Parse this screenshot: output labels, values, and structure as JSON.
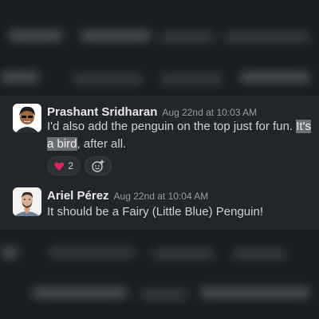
{
  "messages": [
    {
      "author": "Prashant Sridharan",
      "timestamp": "Aug 22nd at 10:03 AM",
      "text_before": "I'd also add the penguin on the top just for fun. ",
      "text_highlight": "It's a bird",
      "text_after": ", after all.",
      "avatar_icon": "cartoon-avatar-icon",
      "reactions": [
        {
          "emoji": "❤️",
          "count": "2",
          "icon": "red-heart-icon"
        }
      ],
      "add_reaction_icon": "add-emoji-icon"
    },
    {
      "author": "Ariel Pérez",
      "timestamp": "Aug 22nd at 10:04 AM",
      "text": "It should be a Fairy (Little Blue) Penguin!",
      "avatar_icon": "photo-avatar-icon"
    }
  ],
  "colors": {
    "background": "#1a1d21",
    "focus_background": "#222529",
    "highlight": "#6b6e73",
    "author_text": "#e8e8e8",
    "body_text": "#d1d2d3",
    "timestamp_text": "#9a9b9e"
  }
}
